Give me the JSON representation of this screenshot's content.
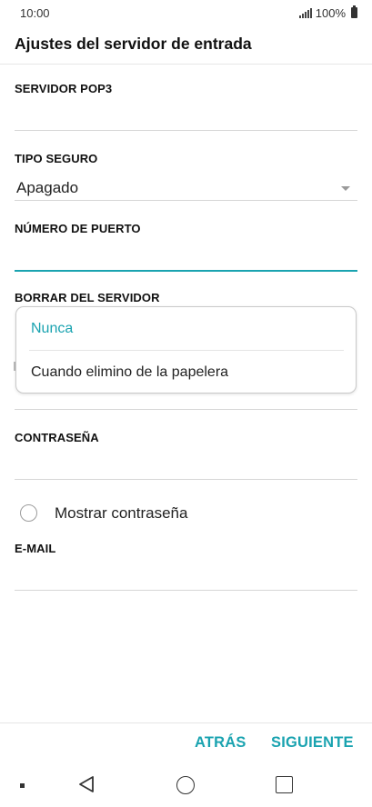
{
  "status_bar": {
    "time": "10:00",
    "battery": "100%"
  },
  "header": {
    "title": "Ajustes del servidor de entrada"
  },
  "fields": {
    "pop3_server": {
      "label": "SERVIDOR POP3",
      "value": ""
    },
    "security_type": {
      "label": "TIPO SEGURO",
      "value": "Apagado"
    },
    "port_number": {
      "label": "NÚMERO DE PUERTO",
      "value": ""
    },
    "delete_from_server": {
      "label": "BORRAR DEL SERVIDOR",
      "options": [
        "Nunca",
        "Cuando elimino de la papelera"
      ],
      "selected": "Nunca"
    },
    "password": {
      "label": "CONTRASEÑA",
      "value": ""
    },
    "show_password": {
      "label": "Mostrar contraseña",
      "checked": false
    },
    "email": {
      "label": "E-MAIL",
      "value": ""
    }
  },
  "actions": {
    "back_label": "ATRÁS",
    "next_label": "SIGUIENTE"
  },
  "colors": {
    "accent": "#1aa3b0",
    "text": "#222222",
    "divider": "#d6d6d6"
  },
  "icons": {
    "signal": "signal-icon",
    "battery": "battery-icon",
    "dropdown": "dropdown-arrow-icon",
    "nav_back": "back-triangle-icon",
    "nav_home": "home-circle-icon",
    "nav_recent": "recent-square-icon"
  }
}
